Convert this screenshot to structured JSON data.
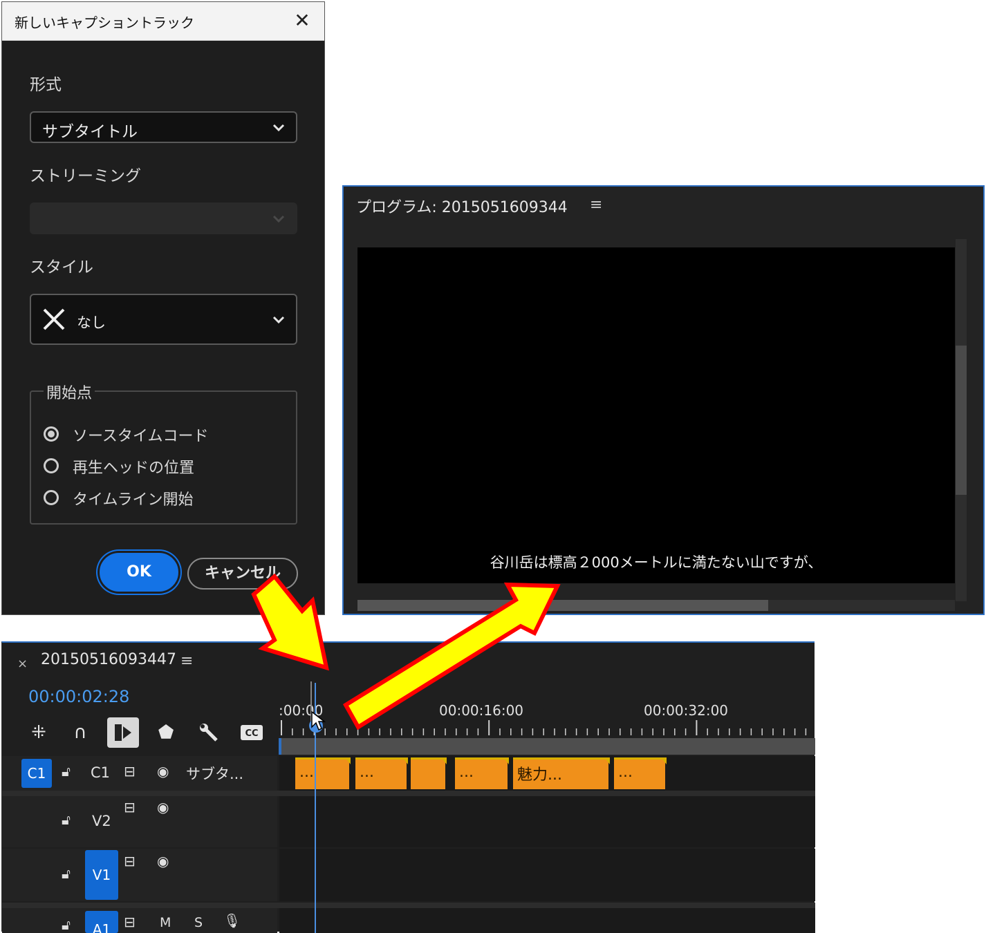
{
  "dialog": {
    "title": "新しいキャプショントラック",
    "format_label": "形式",
    "format_value": "サブタイトル",
    "streaming_label": "ストリーミング",
    "streaming_value": "",
    "style_label": "スタイル",
    "style_value": "なし",
    "start_group_label": "開始点",
    "start_options": [
      {
        "label": "ソースタイムコード",
        "selected": true
      },
      {
        "label": "再生ヘッドの位置",
        "selected": false
      },
      {
        "label": "タイムライン開始",
        "selected": false
      }
    ],
    "ok_label": "OK",
    "cancel_label": "キャンセル"
  },
  "program": {
    "title": "プログラム: 2015051609344",
    "caption_text": "谷川岳は標高２000メートルに満たない山ですが、"
  },
  "timeline": {
    "sequence_name": "20150516093447",
    "timecode": "00:00:02:28",
    "ruler_labels": [
      ":00:00",
      "00:00:16:00",
      "00:00:32:00"
    ],
    "tracks": {
      "c1": {
        "badge": "C1",
        "name": "C1",
        "label": "サブタ..."
      },
      "v2": {
        "name": "V2"
      },
      "v1": {
        "name": "V1"
      },
      "a1": {
        "name": "A1",
        "m": "M",
        "s": "S"
      }
    },
    "clips": [
      "...",
      "...",
      "",
      "...",
      "魅力...",
      "..."
    ]
  },
  "colors": {
    "accent_blue": "#1473e6",
    "clip_orange": "#f0901a",
    "arrow_yellow": "#ffff00",
    "arrow_red": "#ff0000"
  },
  "icons": [
    "close-icon",
    "chevron-down-icon",
    "x-style-icon",
    "menu-icon",
    "snap-icon",
    "magnet-icon",
    "linked-selection-icon",
    "marker-icon",
    "wrench-icon",
    "cc-icon",
    "lock-icon",
    "track-output-icon",
    "eye-icon",
    "mic-icon"
  ]
}
